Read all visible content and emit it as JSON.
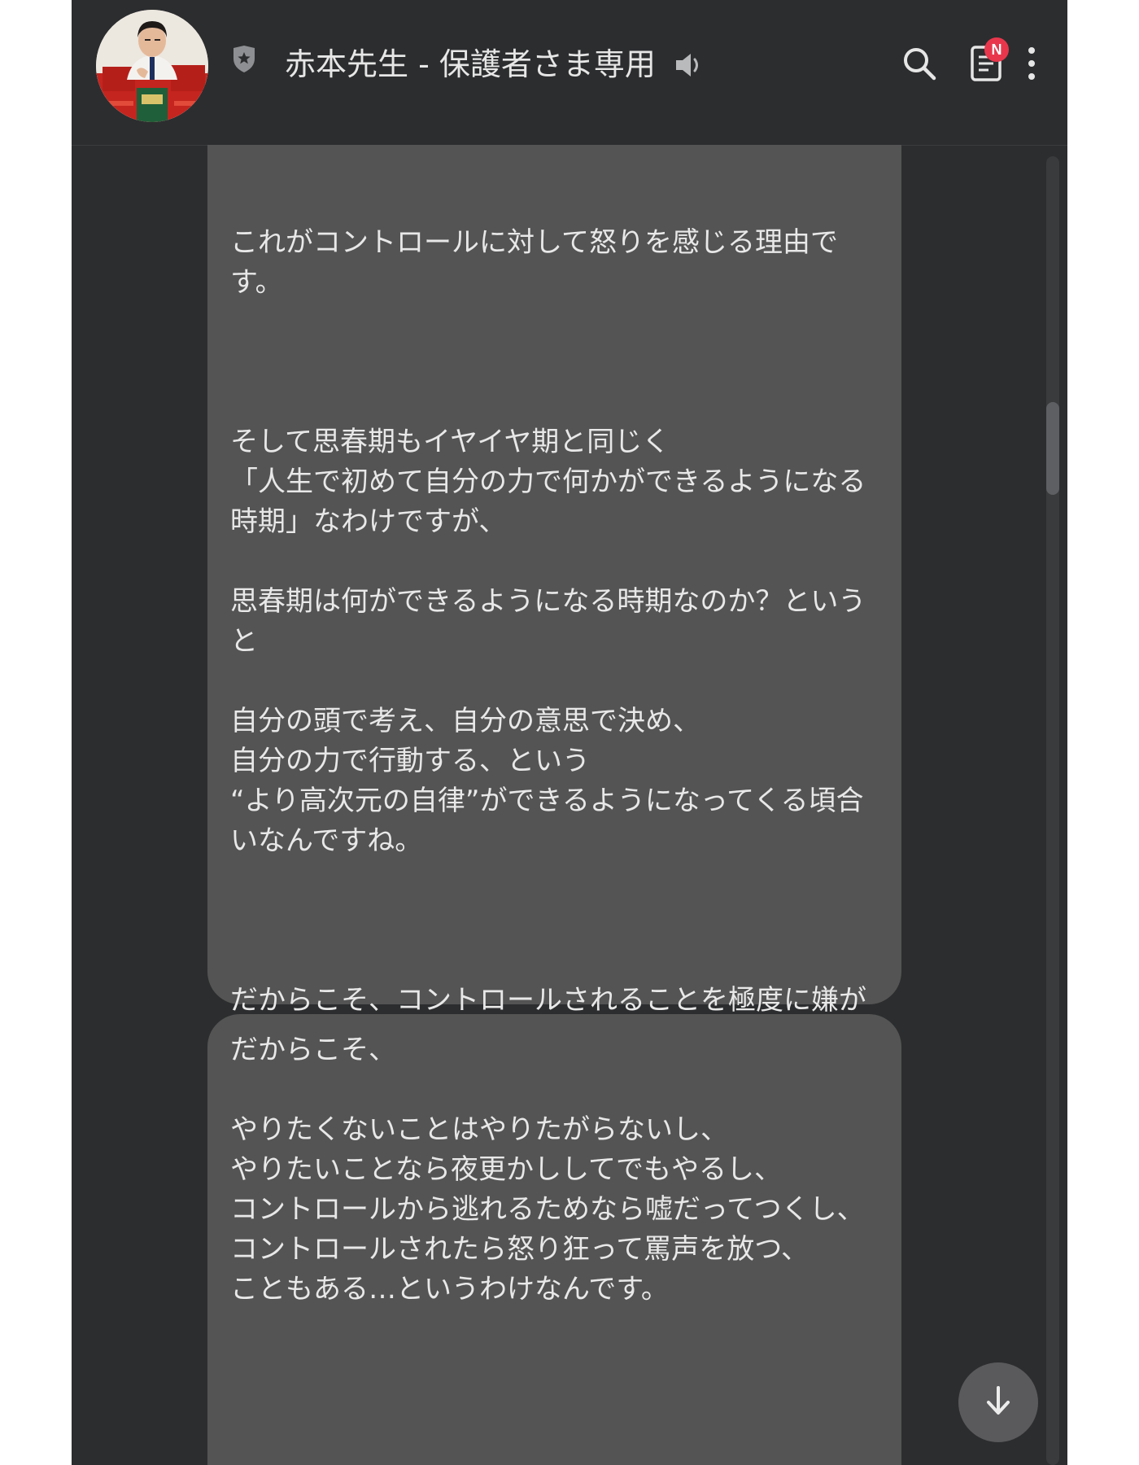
{
  "header": {
    "title": "赤本先生 - 保護者さま専用",
    "notes_badge": "N",
    "icons": [
      "avatar",
      "shield-star-icon",
      "speaker-icon",
      "search-icon",
      "notes-icon",
      "more-vert-icon"
    ]
  },
  "messages": [
    {
      "text": "これがコントロールに対して怒りを感じる理由です。\n\n\n\nそして思春期もイヤイヤ期と同じく\n「人生で初めて自分の力で何かができるようになる時期」なわけですが、\n\n思春期は何ができるようになる時期なのか？というと\n\n自分の頭で考え、自分の意思で決め、\n自分の力で行動する、という\n“より高次元の自律”ができるようになってくる頃合いなんですね。\n\n\n\nだからこそ、コントロールされることを極度に嫌がる。"
    },
    {
      "text": "だからこそ、\n\nやりたくないことはやりたがらないし、\nやりたいことなら夜更かししてでもやるし、\nコントロールから逃れるためなら嘘だってつくし、\nコントロールされたら怒り狂って罵声を放つ、\nこともある…というわけなんです。"
    }
  ],
  "colors": {
    "background": "#2c2d2f",
    "bubble": "#545454",
    "text": "#e8e8e8",
    "badge": "#e8374c"
  }
}
